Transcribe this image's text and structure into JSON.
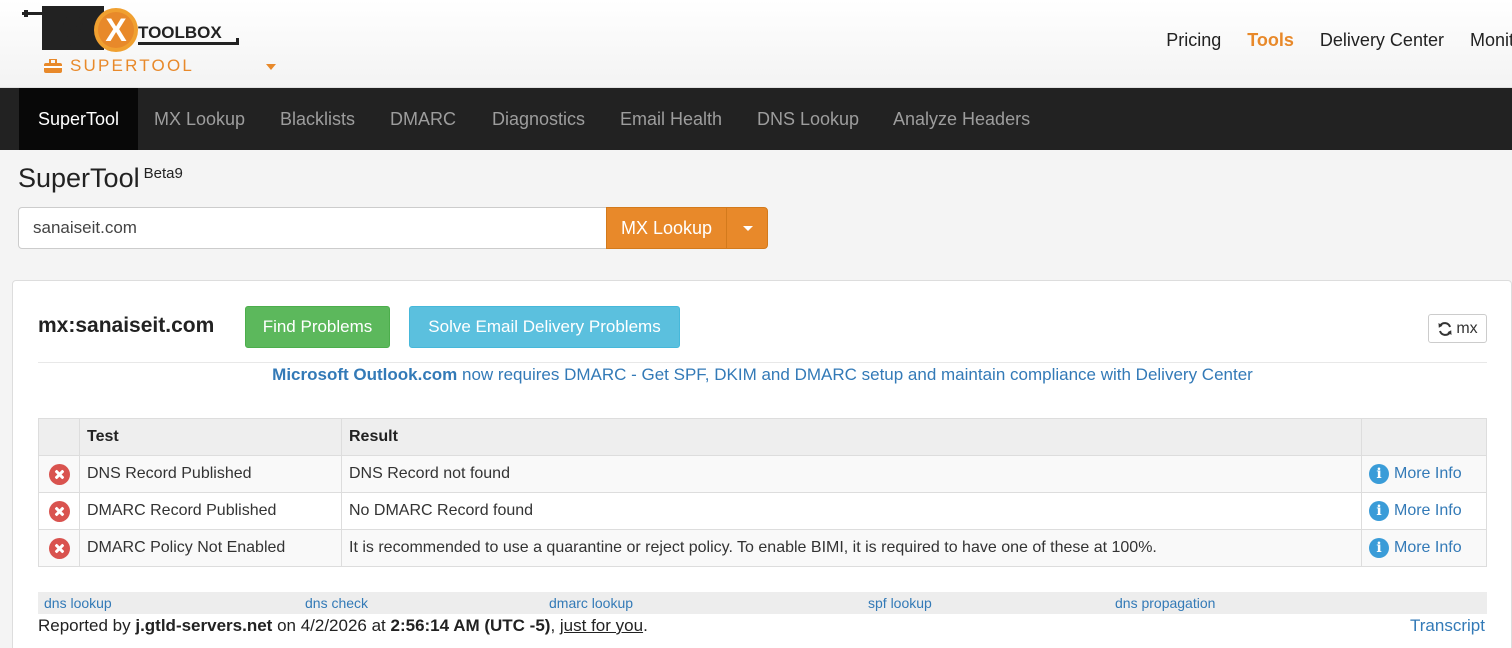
{
  "brand": {
    "logo_m": "M",
    "logo_x": "X",
    "logo_toolbox": "TOOLBOX",
    "supertool_label": "SUPERTOOL",
    "accent_color": "#e8892a"
  },
  "topnav": {
    "items": [
      "Pricing",
      "Tools",
      "Delivery Center",
      "Monito"
    ],
    "active": "Tools"
  },
  "navbar": {
    "tabs": [
      "SuperTool",
      "MX Lookup",
      "Blacklists",
      "DMARC",
      "Diagnostics",
      "Email Health",
      "DNS Lookup",
      "Analyze Headers"
    ],
    "active": "SuperTool"
  },
  "page": {
    "title": "SuperTool",
    "title_sup": "Beta9"
  },
  "search": {
    "value": "sanaiseit.com",
    "button_label": "MX Lookup"
  },
  "result": {
    "title": "mx:sanaiseit.com",
    "find_problems": "Find Problems",
    "solve_problems": "Solve Email Delivery Problems",
    "refresh_label": "mx",
    "banner_bold": "Microsoft Outlook.com",
    "banner_rest": " now requires DMARC - Get SPF, DKIM and DMARC setup and maintain compliance with Delivery Center"
  },
  "table": {
    "headers": {
      "test": "Test",
      "result": "Result"
    },
    "rows": [
      {
        "status": "error",
        "test": "DNS Record Published",
        "result": "DNS Record not found",
        "link": "More Info"
      },
      {
        "status": "error",
        "test": "DMARC Record Published",
        "result": "No DMARC Record found",
        "link": "More Info"
      },
      {
        "status": "error",
        "test": "DMARC Policy Not Enabled",
        "result": "It is recommended to use a quarantine or reject policy. To enable BIMI, it is required to have one of these at 100%.",
        "link": "More Info"
      }
    ]
  },
  "footer": {
    "links": [
      "dns lookup",
      "dns check",
      "dmarc lookup",
      "spf lookup",
      "dns propagation"
    ],
    "reported_by_prefix": "Reported by ",
    "server": "j.gtld-servers.net",
    "on": " on 4/2/2026 at ",
    "time": "2:56:14 AM (UTC -5)",
    "comma": ", ",
    "just_for_you": "just for you",
    "period": ".",
    "transcript": "Transcript"
  }
}
